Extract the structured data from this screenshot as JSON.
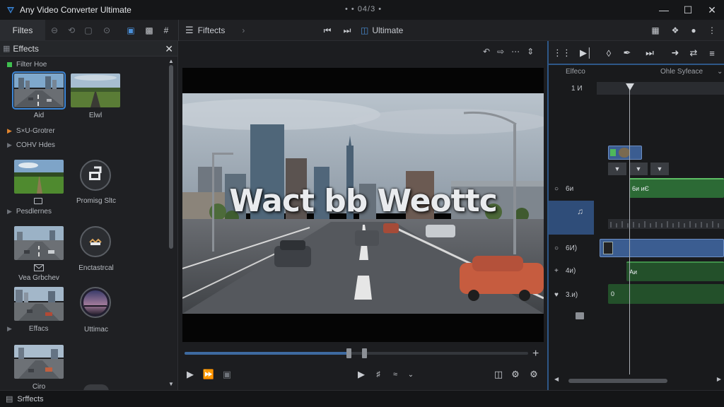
{
  "app": {
    "title": "Any Video Converter Ultimate",
    "center_text": "• • 04/3 •"
  },
  "toolbar": {
    "filters_tab": "Filtes",
    "effects_label": "Fiftects",
    "ultimate_label": "Ultimate"
  },
  "effects_panel": {
    "title": "Effects",
    "sections": [
      "Filter Hoe",
      "S×U-Grotrer",
      "COHV Hdes",
      "Pesdlernes",
      "Effacs"
    ],
    "thumbnails": [
      {
        "label": "Aid"
      },
      {
        "label": "Elwl"
      },
      {
        "label": ""
      },
      {
        "label": "Promisg Sltc"
      },
      {
        "label": "Vea Grbchev"
      },
      {
        "label": "Enctastrcal"
      },
      {
        "label": "Efface"
      },
      {
        "label": "Uttimac"
      },
      {
        "label": "Ciro"
      }
    ]
  },
  "preview": {
    "overlay_title": "Wact bb Weottc",
    "seek_progress": 0.48
  },
  "timeline": {
    "label_left": "Elfeco",
    "label_right": "Ohle Syfeace",
    "ruler_label": "1 И",
    "tracks": [
      {
        "icon": "circle-icon",
        "label": "6и"
      },
      {
        "icon": "circle-icon",
        "label": "6И)"
      },
      {
        "icon": "plus-icon",
        "label": "4и)"
      },
      {
        "icon": "heart-icon",
        "label": "3.и)"
      }
    ],
    "clips": {
      "green_1": "6и иЄ",
      "green_2": "Аи",
      "green_3": "0"
    }
  },
  "status": {
    "label": "Srffects"
  },
  "colors": {
    "accent": "#3d86d6",
    "clip_green": "#2c6a35",
    "clip_blue": "#3b5d91"
  }
}
